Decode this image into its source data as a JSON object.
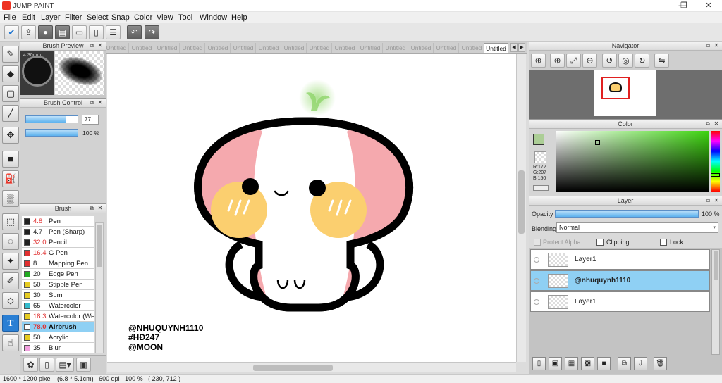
{
  "app": {
    "title": "JUMP PAINT",
    "window_controls": [
      "—",
      "❐",
      "✕"
    ]
  },
  "menu": [
    "File",
    "Edit",
    "Layer",
    "Filter",
    "Select",
    "Snap",
    "Color",
    "View",
    "Tool",
    "Window",
    "Help"
  ],
  "toolbar_icons": [
    "check-icon",
    "export-icon",
    "comment-icon",
    "chat-icon",
    "page-icon",
    "document-icon",
    "list-icon",
    "grid-icon",
    "undo-icon",
    "redo-icon"
  ],
  "tools": [
    "brush-icon",
    "eraser-icon",
    "rect-icon",
    "line-icon",
    "move-icon",
    "fill-rect-icon",
    "bucket-icon",
    "gradient-icon",
    "marquee-icon",
    "lasso-icon",
    "magic-wand-icon",
    "selection-pen-icon",
    "selection-eraser-icon",
    "text-icon",
    "operation-icon"
  ],
  "text_tool_glyph": "T",
  "brush_preview": {
    "title": "Brush Preview",
    "size_label": "4.30mm"
  },
  "brush_control": {
    "title": "Brush Control",
    "size_value": "77",
    "opacity_value": "100 %",
    "size_fraction": 0.77,
    "opacity_fraction": 1.0
  },
  "brush_list": {
    "title": "Brush",
    "items": [
      {
        "size": "4.8",
        "name": "Pen",
        "color": "#222222",
        "red": true
      },
      {
        "size": "4.7",
        "name": "Pen (Sharp)",
        "color": "#222222",
        "red": false
      },
      {
        "size": "32.0",
        "name": "Pencil",
        "color": "#222222",
        "red": true
      },
      {
        "size": "16.4",
        "name": "G Pen",
        "color": "#e03030",
        "red": true
      },
      {
        "size": "8",
        "name": "Mapping Pen",
        "color": "#e03030",
        "red": false
      },
      {
        "size": "20",
        "name": "Edge Pen",
        "color": "#22aa22",
        "red": false
      },
      {
        "size": "50",
        "name": "Stipple Pen",
        "color": "#e6cc22",
        "red": false
      },
      {
        "size": "30",
        "name": "Sumi",
        "color": "#e6cc22",
        "red": false
      },
      {
        "size": "65",
        "name": "Watercolor",
        "color": "#33bbcc",
        "red": false
      },
      {
        "size": "18.3",
        "name": "Watercolor (Wet)",
        "color": "#e6cc22",
        "red": true
      },
      {
        "size": "78.0",
        "name": "Airbrush",
        "color": "#ffffff",
        "red": true,
        "selected": true
      },
      {
        "size": "50",
        "name": "Acrylic",
        "color": "#e6cc22",
        "red": false
      },
      {
        "size": "35",
        "name": "Blur",
        "color": "#f2a0e0",
        "red": false
      }
    ]
  },
  "tabs": [
    "Untitled",
    "Untitled",
    "Untitled",
    "Untitled",
    "Untitled",
    "Untitled",
    "Untitled",
    "Untitled",
    "Untitled",
    "Untitled",
    "Untitled",
    "Untitled",
    "Untitled",
    "Untitled",
    "Untitled",
    "Untitled"
  ],
  "artwork_text": [
    "@NHUQUYNH1110",
    "#HĐ247",
    "@MOON"
  ],
  "navigator": {
    "title": "Navigator"
  },
  "color": {
    "title": "Color",
    "r": "R:172",
    "g": "G:207",
    "b": "B:150",
    "fg": "#acce96"
  },
  "layer": {
    "title": "Layer",
    "opacity_label": "Opacity",
    "opacity_value": "100 %",
    "blending_label": "Blending",
    "blending_value": "Normal",
    "protect_alpha": "Protect Alpha",
    "clipping": "Clipping",
    "lock": "Lock",
    "layers": [
      {
        "name": "Layer1",
        "selected": false
      },
      {
        "name": "@nhuquynh1110",
        "selected": true
      },
      {
        "name": "Layer1",
        "selected": false
      }
    ]
  },
  "status": "1600 * 1200 pixel   (6.8 * 5.1cm)   600 dpi   100 %   ( 230, 712 )"
}
